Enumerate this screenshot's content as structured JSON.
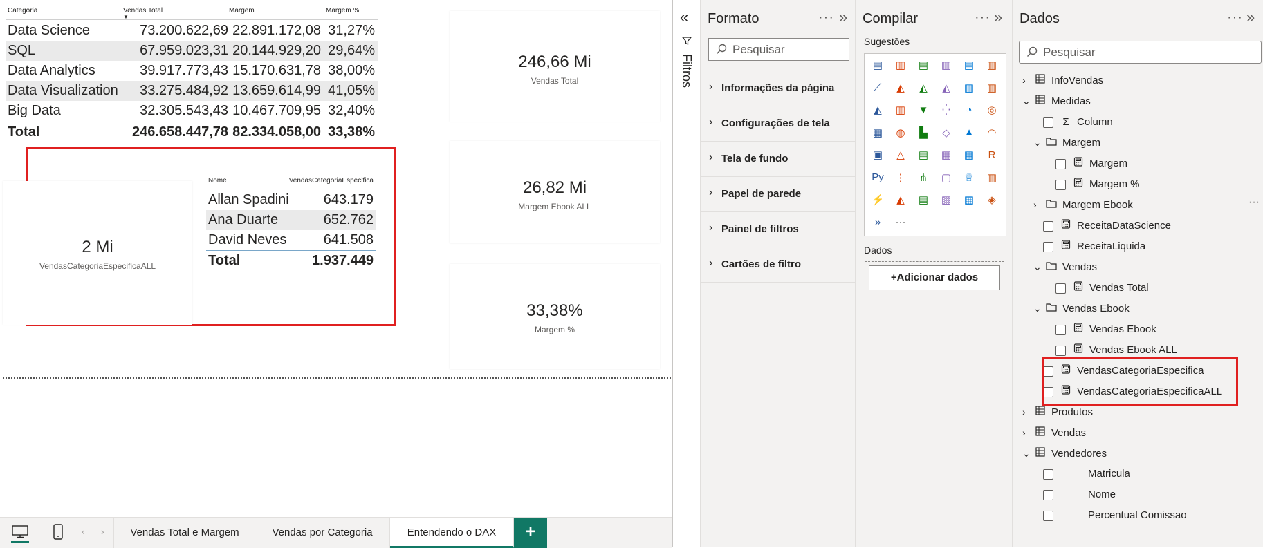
{
  "table1": {
    "headers": [
      "Categoria",
      "Vendas Total",
      "Margem",
      "Margem %"
    ],
    "rows": [
      [
        "Data Science",
        "73.200.622,69",
        "22.891.172,08",
        "31,27%"
      ],
      [
        "SQL",
        "67.959.023,31",
        "20.144.929,20",
        "29,64%"
      ],
      [
        "Data Analytics",
        "39.917.773,43",
        "15.170.631,78",
        "38,00%"
      ],
      [
        "Data Visualization",
        "33.275.484,92",
        "13.659.614,99",
        "41,05%"
      ],
      [
        "Big Data",
        "32.305.543,43",
        "10.467.709,95",
        "32,40%"
      ]
    ],
    "total": [
      "Total",
      "246.658.447,78",
      "82.334.058,00",
      "33,38%"
    ]
  },
  "card_left": {
    "value": "2 Mi",
    "label": "VendasCategoriaEspecificaALL"
  },
  "table2": {
    "headers": [
      "Nome",
      "VendasCategoriaEspecifica"
    ],
    "rows": [
      [
        "Allan Spadini",
        "643.179"
      ],
      [
        "Ana Duarte",
        "652.762"
      ],
      [
        "David Neves",
        "641.508"
      ]
    ],
    "total": [
      "Total",
      "1.937.449"
    ]
  },
  "cards": [
    {
      "value": "246,66 Mi",
      "label": "Vendas Total"
    },
    {
      "value": "26,82 Mi",
      "label": "Margem Ebook ALL"
    },
    {
      "value": "33,38%",
      "label": "Margem %"
    }
  ],
  "highlight_color": "#e02020",
  "accent_color": "#117865",
  "tabs": {
    "items": [
      "Vendas Total e Margem",
      "Vendas por Categoria",
      "Entendendo o DAX"
    ],
    "active": "Entendendo o DAX",
    "add_label": "+"
  },
  "filters": {
    "label": "Filtros"
  },
  "format_pane": {
    "title": "Formato",
    "search_placeholder": "Pesquisar",
    "sections": [
      "Informações da página",
      "Configurações de tela",
      "Tela de fundo",
      "Papel de parede",
      "Painel de filtros",
      "Cartões de filtro"
    ]
  },
  "build_pane": {
    "title": "Compilar",
    "suggestions_label": "Sugestões",
    "data_label": "Dados",
    "add_data_label": "+Adicionar dados"
  },
  "data_pane": {
    "title": "Dados",
    "search_placeholder": "Pesquisar",
    "tree": [
      {
        "label": "InfoVendas",
        "type": "table"
      },
      {
        "label": "Medidas",
        "type": "table"
      },
      {
        "label": "Column",
        "type": "sigma"
      },
      {
        "label": "Margem",
        "type": "folder"
      },
      {
        "label": "Margem",
        "type": "measure"
      },
      {
        "label": "Margem %",
        "type": "measure"
      },
      {
        "label": "Margem Ebook",
        "type": "folder"
      },
      {
        "label": "ReceitaDataScience",
        "type": "measure"
      },
      {
        "label": "ReceitaLiquida",
        "type": "measure"
      },
      {
        "label": "Vendas",
        "type": "folder"
      },
      {
        "label": "Vendas Total",
        "type": "measure"
      },
      {
        "label": "Vendas Ebook",
        "type": "folder"
      },
      {
        "label": "Vendas Ebook",
        "type": "measure"
      },
      {
        "label": "Vendas Ebook ALL",
        "type": "measure"
      },
      {
        "label": "VendasCategoriaEspecifica",
        "type": "measure"
      },
      {
        "label": "VendasCategoriaEspecificaALL",
        "type": "measure"
      },
      {
        "label": "Produtos",
        "type": "table"
      },
      {
        "label": "Vendas",
        "type": "table"
      },
      {
        "label": "Vendedores",
        "type": "table"
      },
      {
        "label": "Matricula",
        "type": "field"
      },
      {
        "label": "Nome",
        "type": "field"
      },
      {
        "label": "Percentual Comissao",
        "type": "field"
      }
    ]
  },
  "icons": {
    "search": "search-icon",
    "chevron_right": "chevron-right-icon",
    "chevron_down": "chevron-down-icon",
    "table": "table-icon",
    "folder": "folder-icon",
    "measure": "calculator-icon",
    "sigma": "sigma-icon",
    "filter": "filter-icon",
    "desktop": "desktop-icon",
    "mobile": "mobile-icon"
  },
  "more_label": "···"
}
